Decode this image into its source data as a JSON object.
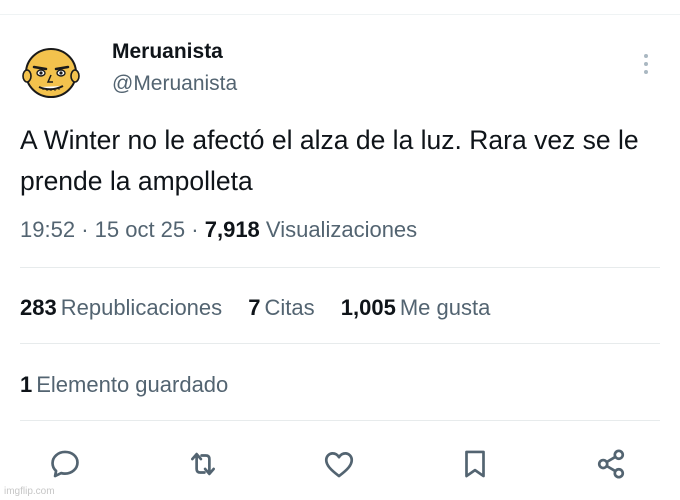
{
  "user": {
    "display_name": "Meruanista",
    "handle": "@Meruanista"
  },
  "tweet": {
    "text": "A Winter no le afectó el alza de la luz. Rara vez se le prende la ampolleta",
    "time": "19:52",
    "date": "15 oct 25",
    "separator": "·",
    "views_count": "7,918",
    "views_label": "Visualizaciones"
  },
  "stats": {
    "retweets_count": "283",
    "retweets_label": "Republicaciones",
    "quotes_count": "7",
    "quotes_label": "Citas",
    "likes_count": "1,005",
    "likes_label": "Me gusta",
    "bookmarks_count": "1",
    "bookmarks_label": "Elemento guardado"
  },
  "actions": [
    {
      "icon": "reply-icon"
    },
    {
      "icon": "retweet-icon"
    },
    {
      "icon": "like-icon"
    },
    {
      "icon": "bookmark-icon"
    },
    {
      "icon": "share-icon"
    }
  ],
  "watermark": "imgflip.com",
  "colors": {
    "primary_text": "#0f1419",
    "secondary_text": "#536471",
    "divider": "#e7ebec",
    "avatar_skin": "#f3c24d"
  }
}
